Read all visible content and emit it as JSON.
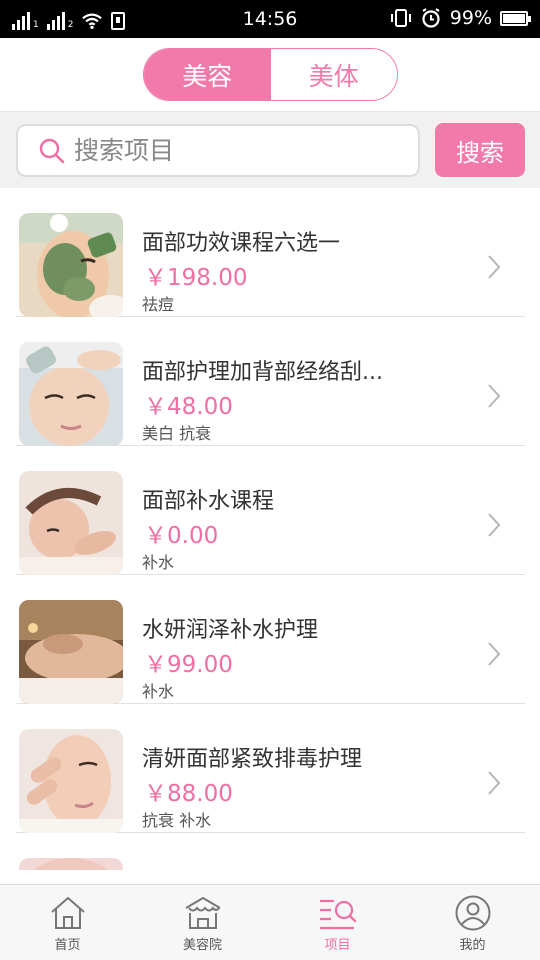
{
  "status_bar": {
    "time": "14:56",
    "battery_percent": "99%",
    "sim1": "1",
    "sim2": "2",
    "battery_level": 0.99
  },
  "segment": {
    "tabs": [
      {
        "label": "美容",
        "active": true
      },
      {
        "label": "美体",
        "active": false
      }
    ]
  },
  "search": {
    "placeholder": "搜索项目",
    "button_label": "搜索"
  },
  "colors": {
    "accent": "#f17aab",
    "price": "#ef6fa4"
  },
  "items": [
    {
      "title": "面部功效课程六选一",
      "price": "￥198.00",
      "tags": "祛痘"
    },
    {
      "title": "面部护理加背部经络刮...",
      "price": "￥48.00",
      "tags": "美白 抗衰"
    },
    {
      "title": "面部补水课程",
      "price": "￥0.00",
      "tags": "补水"
    },
    {
      "title": "水妍润泽补水护理",
      "price": "￥99.00",
      "tags": "补水"
    },
    {
      "title": "清妍面部紧致排毒护理",
      "price": "￥88.00",
      "tags": "抗衰 补水"
    }
  ],
  "tabbar": {
    "items": [
      {
        "label": "首页",
        "icon": "home-icon"
      },
      {
        "label": "美容院",
        "icon": "salon-icon"
      },
      {
        "label": "项目",
        "icon": "project-search-icon"
      },
      {
        "label": "我的",
        "icon": "profile-icon"
      }
    ]
  }
}
